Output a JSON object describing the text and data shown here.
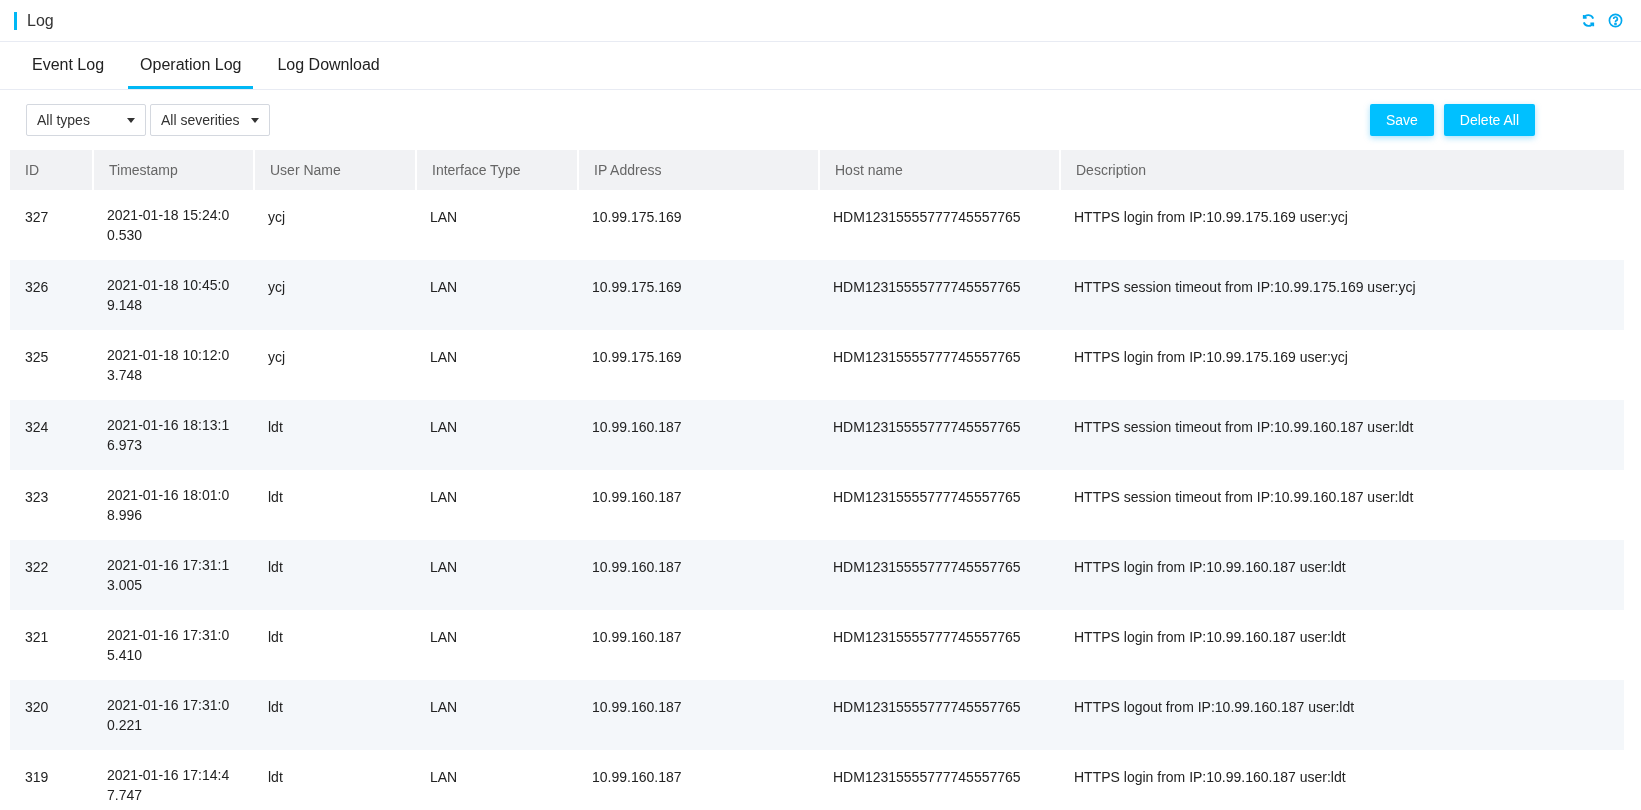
{
  "header": {
    "title": "Log"
  },
  "tabs": [
    {
      "label": "Event Log",
      "selected": false
    },
    {
      "label": "Operation Log",
      "selected": true
    },
    {
      "label": "Log Download",
      "selected": false
    }
  ],
  "filters": [
    {
      "value": "All types"
    },
    {
      "value": "All severities"
    }
  ],
  "buttons": [
    "Save",
    "Delete All"
  ],
  "table": {
    "columns": [
      "ID",
      "Timestamp",
      "User Name",
      "Interface Type",
      "IP Address",
      "Host name",
      "Description"
    ],
    "rows": [
      [
        "327",
        "2021-01-18 15:24:00.530",
        "ycj",
        "LAN",
        "10.99.175.169",
        "HDM12315555777745557765",
        "HTTPS login from IP:10.99.175.169 user:ycj"
      ],
      [
        "326",
        "2021-01-18 10:45:09.148",
        "ycj",
        "LAN",
        "10.99.175.169",
        "HDM12315555777745557765",
        "HTTPS session timeout from IP:10.99.175.169 user:ycj"
      ],
      [
        "325",
        "2021-01-18 10:12:03.748",
        "ycj",
        "LAN",
        "10.99.175.169",
        "HDM12315555777745557765",
        "HTTPS login from IP:10.99.175.169 user:ycj"
      ],
      [
        "324",
        "2021-01-16 18:13:16.973",
        "ldt",
        "LAN",
        "10.99.160.187",
        "HDM12315555777745557765",
        "HTTPS session timeout from IP:10.99.160.187 user:ldt"
      ],
      [
        "323",
        "2021-01-16 18:01:08.996",
        "ldt",
        "LAN",
        "10.99.160.187",
        "HDM12315555777745557765",
        "HTTPS session timeout from IP:10.99.160.187 user:ldt"
      ],
      [
        "322",
        "2021-01-16 17:31:13.005",
        "ldt",
        "LAN",
        "10.99.160.187",
        "HDM12315555777745557765",
        "HTTPS login from IP:10.99.160.187 user:ldt"
      ],
      [
        "321",
        "2021-01-16 17:31:05.410",
        "ldt",
        "LAN",
        "10.99.160.187",
        "HDM12315555777745557765",
        "HTTPS login from IP:10.99.160.187 user:ldt"
      ],
      [
        "320",
        "2021-01-16 17:31:00.221",
        "ldt",
        "LAN",
        "10.99.160.187",
        "HDM12315555777745557765",
        "HTTPS logout from IP:10.99.160.187 user:ldt"
      ],
      [
        "319",
        "2021-01-16 17:14:47.747",
        "ldt",
        "LAN",
        "10.99.160.187",
        "HDM12315555777745557765",
        "HTTPS login from IP:10.99.160.187 user:ldt"
      ]
    ]
  }
}
